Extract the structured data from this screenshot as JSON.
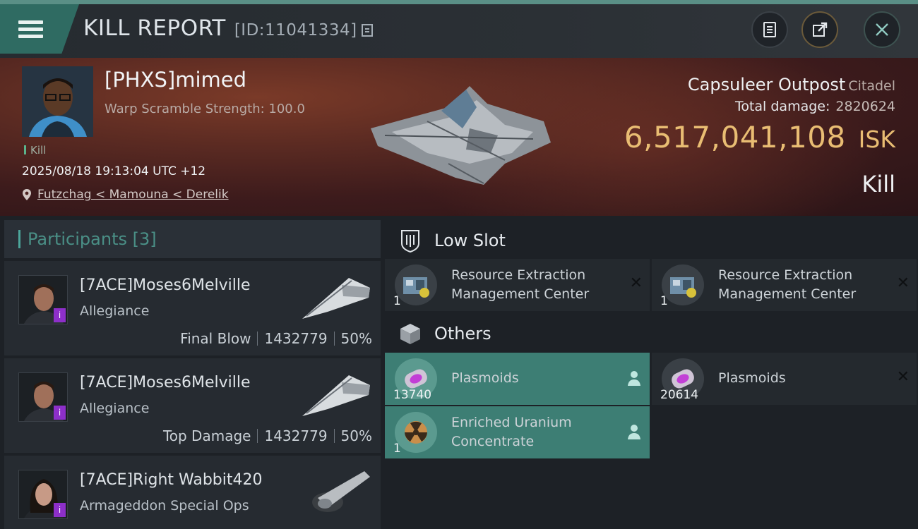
{
  "header": {
    "title": "KILL REPORT",
    "report_id": "[ID:11041334]"
  },
  "victim": {
    "name": "[PHXS]mimed",
    "subtitle": "Warp Scramble Strength: 100.0",
    "tag": "Kill",
    "datetime": "2025/08/18 19:13:04 UTC +12",
    "location": "Futzchag < Mamouna < Derelik"
  },
  "target": {
    "name": "Capsuleer Outpost",
    "type": "Citadel",
    "total_damage_label": "Total damage:",
    "total_damage": "2820624",
    "isk_value": "6,517,041,108",
    "isk_unit": "ISK",
    "result": "Kill"
  },
  "participants": {
    "label": "Participants",
    "count": "[3]",
    "list": [
      {
        "name": "[7ACE]Moses6Melville",
        "ship": "Allegiance",
        "role": "Final Blow",
        "damage": "1432779",
        "percent": "50%"
      },
      {
        "name": "[7ACE]Moses6Melville",
        "ship": "Allegiance",
        "role": "Top Damage",
        "damage": "1432779",
        "percent": "50%"
      },
      {
        "name": "[7ACE]Right Wabbit420",
        "ship": "Armageddon Special Ops"
      }
    ]
  },
  "low_slot": {
    "label": "Low Slot",
    "items": [
      {
        "name_line1": "Resource Extraction",
        "name_line2": "Management Center",
        "qty": "1"
      },
      {
        "name_line1": "Resource Extraction",
        "name_line2": "Management Center",
        "qty": "1"
      }
    ]
  },
  "others": {
    "label": "Others",
    "items": [
      {
        "name": "Plasmoids",
        "qty": "13740",
        "status": "dropped"
      },
      {
        "name": "Plasmoids",
        "qty": "20614",
        "status": "destroyed"
      },
      {
        "name_line1": "Enriched Uranium",
        "name_line2": "Concentrate",
        "qty": "1",
        "status": "dropped"
      }
    ]
  },
  "colors": {
    "accent": "#3d7e74",
    "isk": "#e9bd73",
    "topline": "#5a8f86"
  }
}
